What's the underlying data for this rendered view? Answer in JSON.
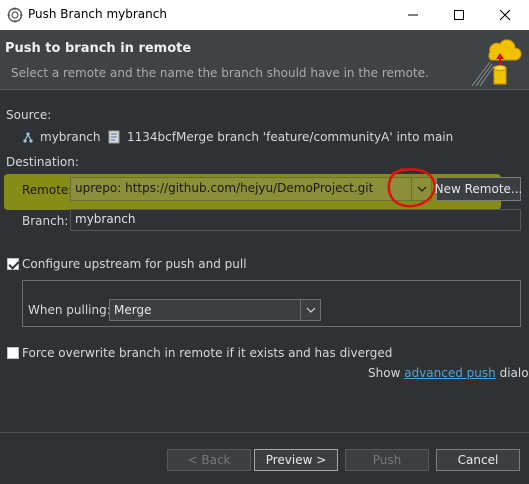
{
  "window": {
    "title": "Push Branch mybranch"
  },
  "banner": {
    "heading": "Push to branch in remote",
    "description": "Select a remote and the name the branch should have in the remote."
  },
  "source": {
    "label": "Source:",
    "branch": "mybranch",
    "commit_id": "1134bcf",
    "commit_message": "Merge branch 'feature/communityA' into main"
  },
  "destination": {
    "label": "Destination:",
    "remote_label": "Remote:",
    "remote_value": "uprepo: https://github.com/hejyu/DemoProject.git",
    "new_remote_button": "New Remote...",
    "branch_label": "Branch:",
    "branch_value": "mybranch"
  },
  "options": {
    "configure_upstream_label": "Configure upstream for push and pull",
    "configure_upstream_checked": true,
    "when_pulling_label": "When pulling:",
    "when_pulling_value": "Merge",
    "force_overwrite_label": "Force overwrite branch in remote if it exists and has diverged",
    "force_overwrite_checked": false
  },
  "advanced": {
    "prefix": "Show",
    "link": "advanced push",
    "suffix": "dialog"
  },
  "buttons": {
    "back": "< Back",
    "preview": "Preview >",
    "push": "Push",
    "cancel": "Cancel"
  },
  "colors": {
    "background": "#2f3234",
    "highlight": "#cfd600",
    "annotation_circle": "#e01010",
    "link": "#4da3d6"
  }
}
